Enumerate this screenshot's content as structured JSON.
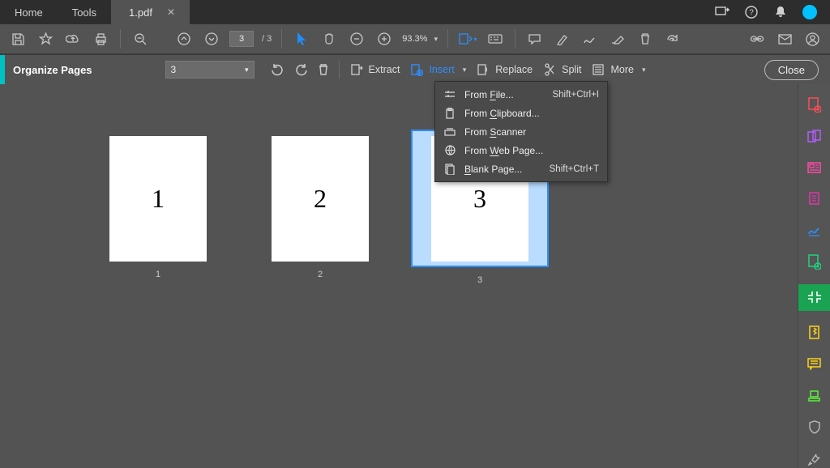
{
  "tabs": {
    "home": "Home",
    "tools": "Tools",
    "file": "1.pdf"
  },
  "toolbar": {
    "page_current": "3",
    "page_total": "/ 3",
    "zoom": "93.3%"
  },
  "orgbar": {
    "title": "Organize Pages",
    "range_value": "3",
    "extract": "Extract",
    "insert": "Insert",
    "replace": "Replace",
    "split": "Split",
    "more": "More",
    "close": "Close"
  },
  "thumbs": {
    "p1": "1",
    "p1_label": "1",
    "p2": "2",
    "p2_label": "2",
    "p3": "3",
    "p3_label": "3"
  },
  "insert_menu": {
    "from_file": {
      "pre": "From ",
      "u": "F",
      "post": "ile...",
      "shortcut": "Shift+Ctrl+I"
    },
    "from_clipboard": {
      "pre": "From ",
      "u": "C",
      "post": "lipboard..."
    },
    "from_scanner": {
      "pre": "From ",
      "u": "S",
      "post": "canner"
    },
    "from_web": {
      "pre": "From ",
      "u": "W",
      "post": "eb Page..."
    },
    "blank": {
      "u": "B",
      "post": "lank Page...",
      "shortcut": "Shift+Ctrl+T"
    }
  }
}
